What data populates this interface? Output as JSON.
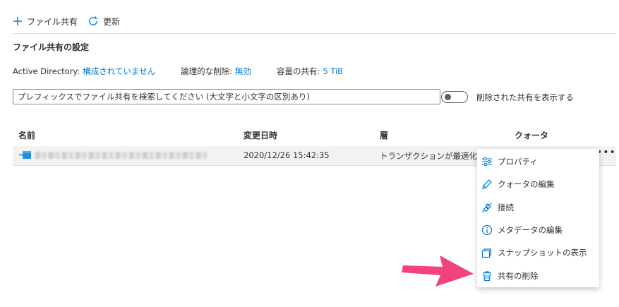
{
  "toolbar": {
    "add_label": "ファイル共有",
    "refresh_label": "更新"
  },
  "settings": {
    "title": "ファイル共有の設定",
    "active_directory_label": "Active Directory:",
    "active_directory_value": "構成されていません",
    "soft_delete_label": "論理的な削除:",
    "soft_delete_value": "無効",
    "quota_label": "容量の共有:",
    "quota_value": "5 TiB"
  },
  "search": {
    "placeholder": "プレフィックスでファイル共有を検索してください (大文字と小文字の区別あり)"
  },
  "toggle": {
    "label": "削除された共有を表示する",
    "on": false
  },
  "table": {
    "headers": [
      "名前",
      "変更日時",
      "層",
      "クォータ"
    ],
    "rows": [
      {
        "name": "",
        "modified": "2020/12/26 15:42:35",
        "tier": "トランザクションが最適化"
      }
    ]
  },
  "context_menu": {
    "items": [
      {
        "label": "プロパティ",
        "icon": "sliders-icon"
      },
      {
        "label": "クォータの編集",
        "icon": "pencil-icon"
      },
      {
        "label": "接続",
        "icon": "plug-icon"
      },
      {
        "label": "メタデータの編集",
        "icon": "info-icon"
      },
      {
        "label": "スナップショットの表示",
        "icon": "snapshot-icon"
      },
      {
        "label": "共有の削除",
        "icon": "trash-icon"
      }
    ]
  },
  "colors": {
    "accent": "#0078d4",
    "arrow": "#f2447a",
    "row_selected": "#f3f2f1"
  }
}
